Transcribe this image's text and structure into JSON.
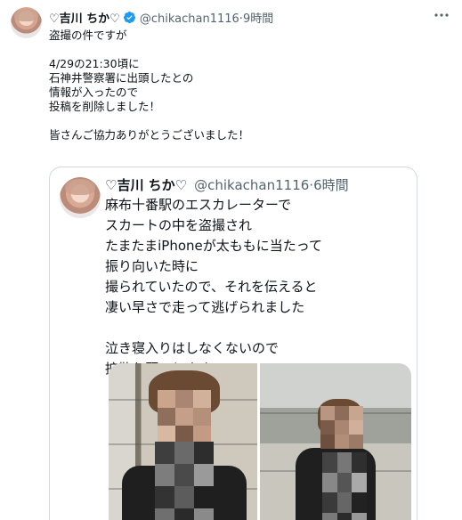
{
  "tweet": {
    "display_name": "♡吉川 ちか♡",
    "handle": "@chikachan1116",
    "time": "9時間",
    "text": "盗撮の件ですが\n\n4/29の21:30頃に\n石神井警察署に出頭したとの\n情報が入ったので\n投稿を削除しました！\n\n皆さんご協力ありがとうございました！"
  },
  "quote": {
    "display_name": "♡吉川 ちか♡",
    "handle": "@chikachan1116",
    "time": "6時間",
    "text": "麻布十番駅のエスカレーターで\nスカートの中を盗撮され\nたまたまiPhoneが太ももに当たって\n振り向いた時に\n撮られていたので、それを伝えると\n凄い早さで走って逃げられました\n\n泣き寝入りはしなくないので\n拡散お願いします。"
  },
  "icons": {
    "verified": "verified-badge-icon",
    "more": "more-options-icon"
  },
  "colors": {
    "verified_blue": "#1d9bf0",
    "secondary_text": "#536471",
    "border": "#cfd9de"
  }
}
